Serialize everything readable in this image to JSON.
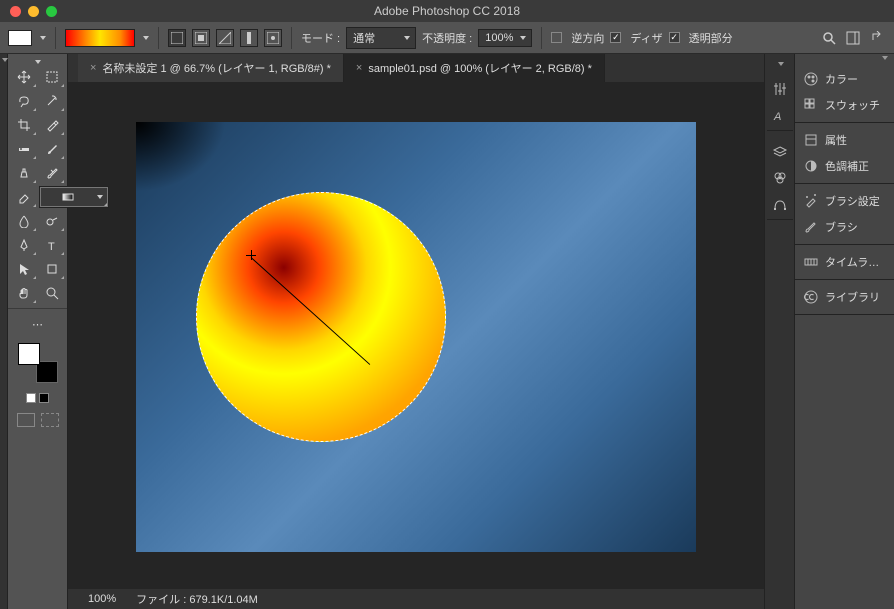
{
  "app_title": "Adobe Photoshop CC 2018",
  "options_bar": {
    "mode_label": "モード :",
    "mode_value": "通常",
    "opacity_label": "不透明度 :",
    "opacity_value": "100%",
    "reverse_label": "逆方向",
    "dither_label": "ディザ",
    "transparency_label": "透明部分"
  },
  "tabs": [
    {
      "label": "名称未設定 1 @ 66.7% (レイヤー 1, RGB/8#) *",
      "active": false
    },
    {
      "label": "sample01.psd @ 100% (レイヤー 2, RGB/8) *",
      "active": true
    }
  ],
  "status": {
    "zoom": "100%",
    "file_label": "ファイル :",
    "file_info": "679.1K/1.04M"
  },
  "panels": {
    "color": "カラー",
    "swatches": "スウォッチ",
    "properties": "属性",
    "adjustments": "色調補正",
    "brush_settings": "ブラシ設定",
    "brushes": "ブラシ",
    "timeline": "タイムラ…",
    "libraries": "ライブラリ"
  }
}
